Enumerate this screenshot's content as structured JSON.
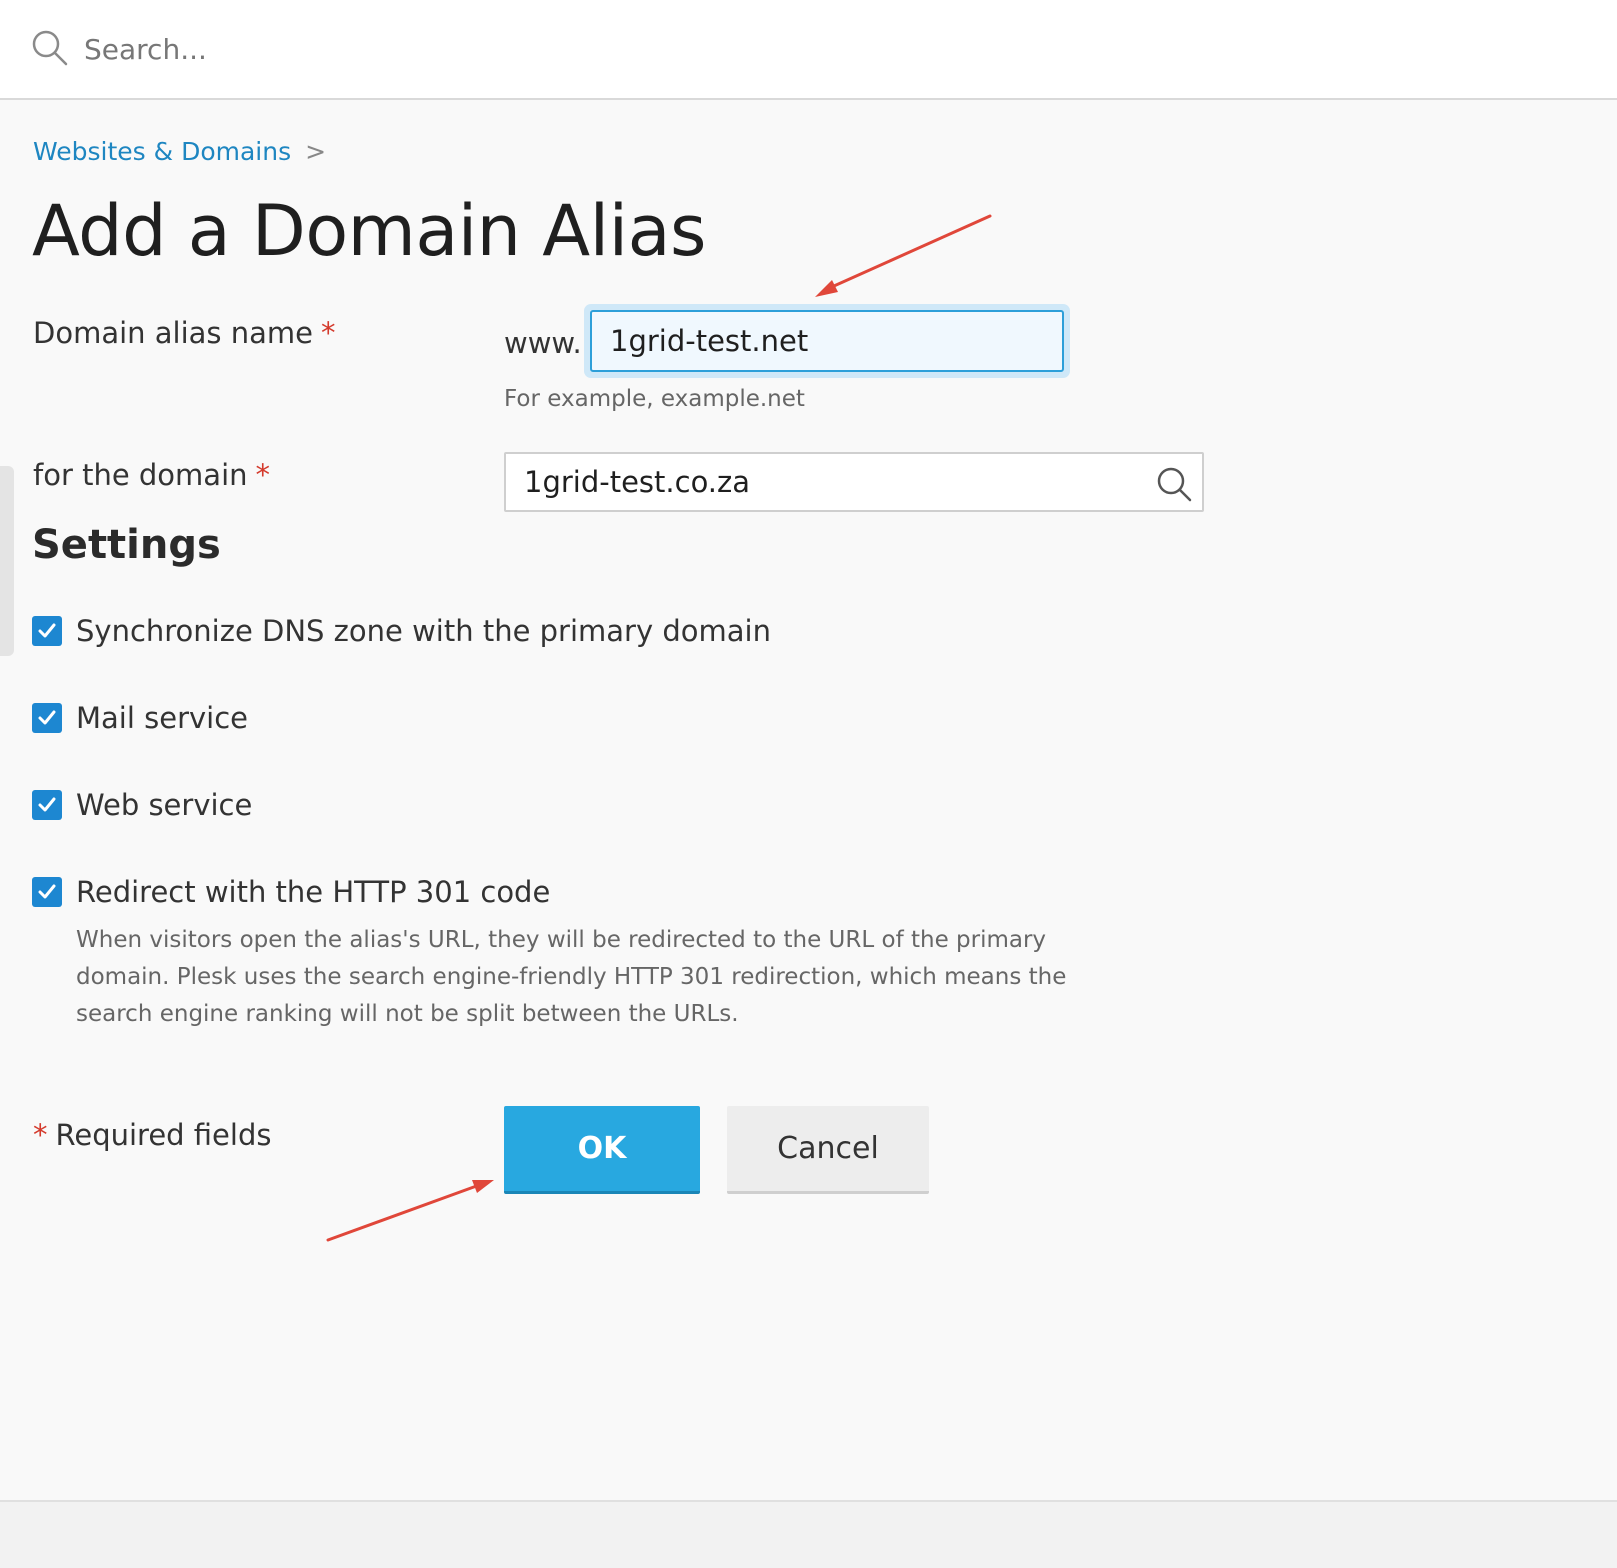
{
  "search": {
    "placeholder": "Search..."
  },
  "breadcrumb": {
    "items": [
      {
        "label": "Websites & Domains"
      }
    ],
    "separator": ">"
  },
  "page": {
    "title": "Add a Domain Alias"
  },
  "form": {
    "alias_name": {
      "label": "Domain alias name",
      "required_mark": "*",
      "prefix": "www.",
      "value": "1grid-test.net",
      "hint": "For example, example.net"
    },
    "for_domain": {
      "label": "for the domain",
      "required_mark": "*",
      "value": "1grid-test.co.za"
    }
  },
  "settings": {
    "title": "Settings",
    "options": [
      {
        "label": "Synchronize DNS zone with the primary domain",
        "checked": true
      },
      {
        "label": "Mail service",
        "checked": true
      },
      {
        "label": "Web service",
        "checked": true
      },
      {
        "label": "Redirect with the HTTP 301 code",
        "checked": true,
        "description": "When visitors open the alias's URL, they will be redirected to the URL of the primary domain. Plesk uses the search engine-friendly HTTP 301 redirection, which means the search engine ranking will not be split between the URLs."
      }
    ]
  },
  "footer": {
    "required_mark": "*",
    "required_note": "Required fields"
  },
  "buttons": {
    "ok_label": "OK",
    "cancel_label": "Cancel"
  },
  "colors": {
    "accent": "#28a8e0",
    "link": "#1e86c1",
    "checkbox": "#1d87d1",
    "required": "#d43a2c",
    "annotation_arrow": "#e0473a"
  }
}
